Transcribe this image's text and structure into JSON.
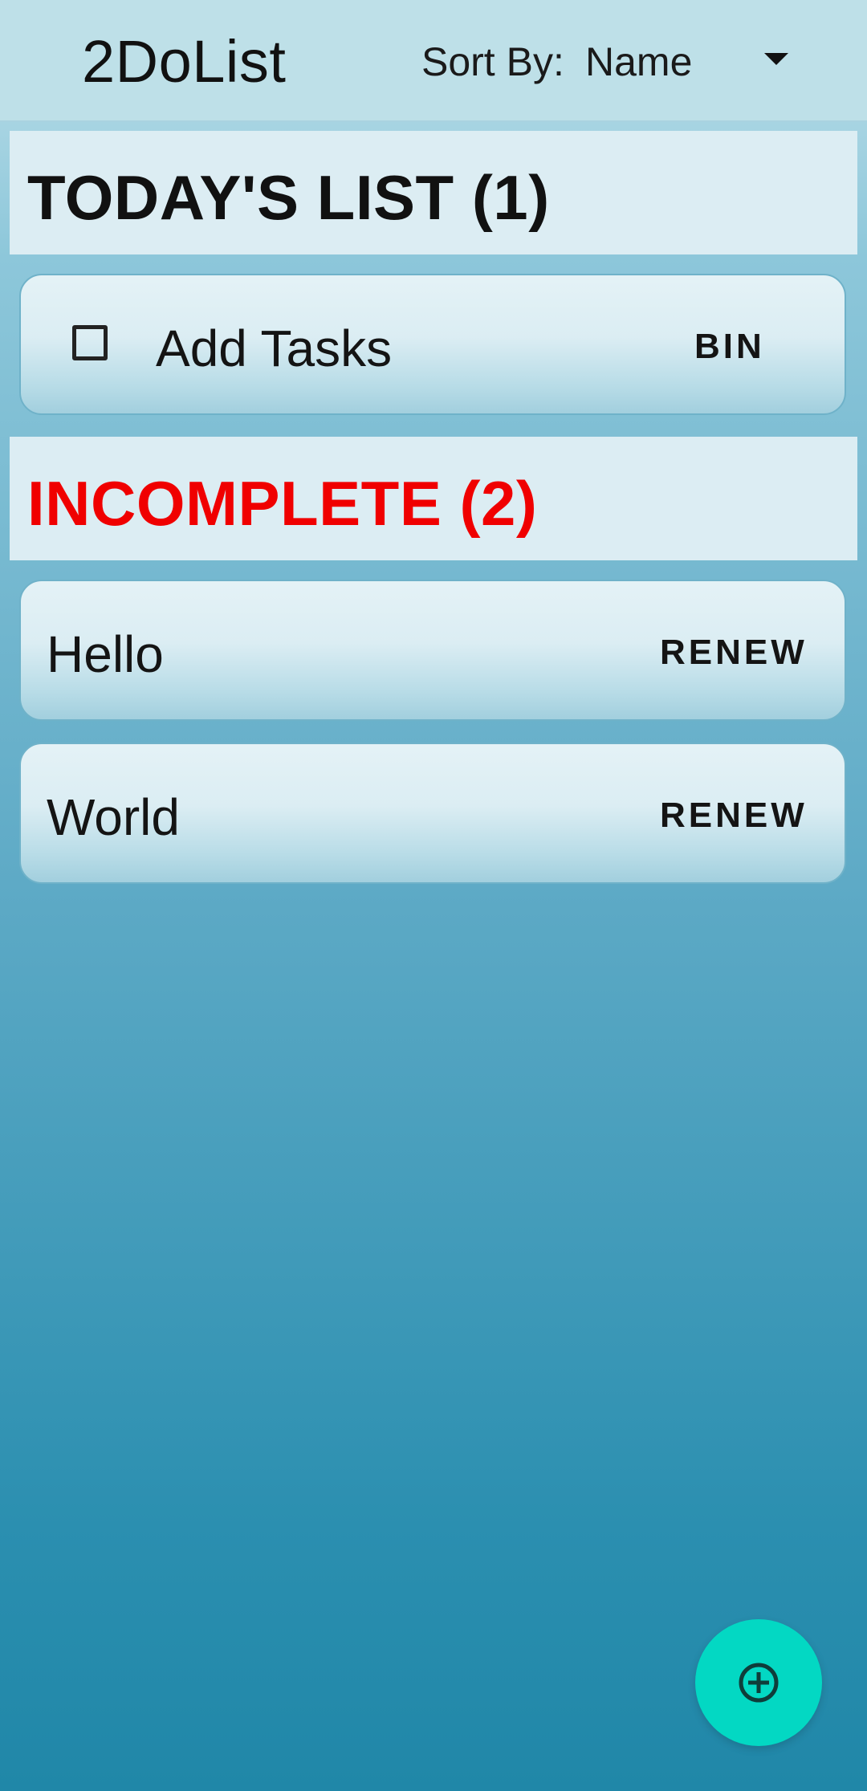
{
  "app_bar": {
    "title": "2DoList",
    "sort_label": "Sort By:",
    "sort_value": "Name"
  },
  "sections": {
    "today": {
      "title": "TODAY'S LIST (1)",
      "items": [
        {
          "label": "Add Tasks",
          "action": "BIN",
          "checked": false
        }
      ]
    },
    "incomplete": {
      "title": "INCOMPLETE (2)",
      "color": "#ff0000",
      "items": [
        {
          "label": "Hello",
          "action": "RENEW"
        },
        {
          "label": "World",
          "action": "RENEW"
        }
      ]
    }
  },
  "fab": {
    "icon": "add-circle-icon",
    "color": "#03d8c3"
  }
}
